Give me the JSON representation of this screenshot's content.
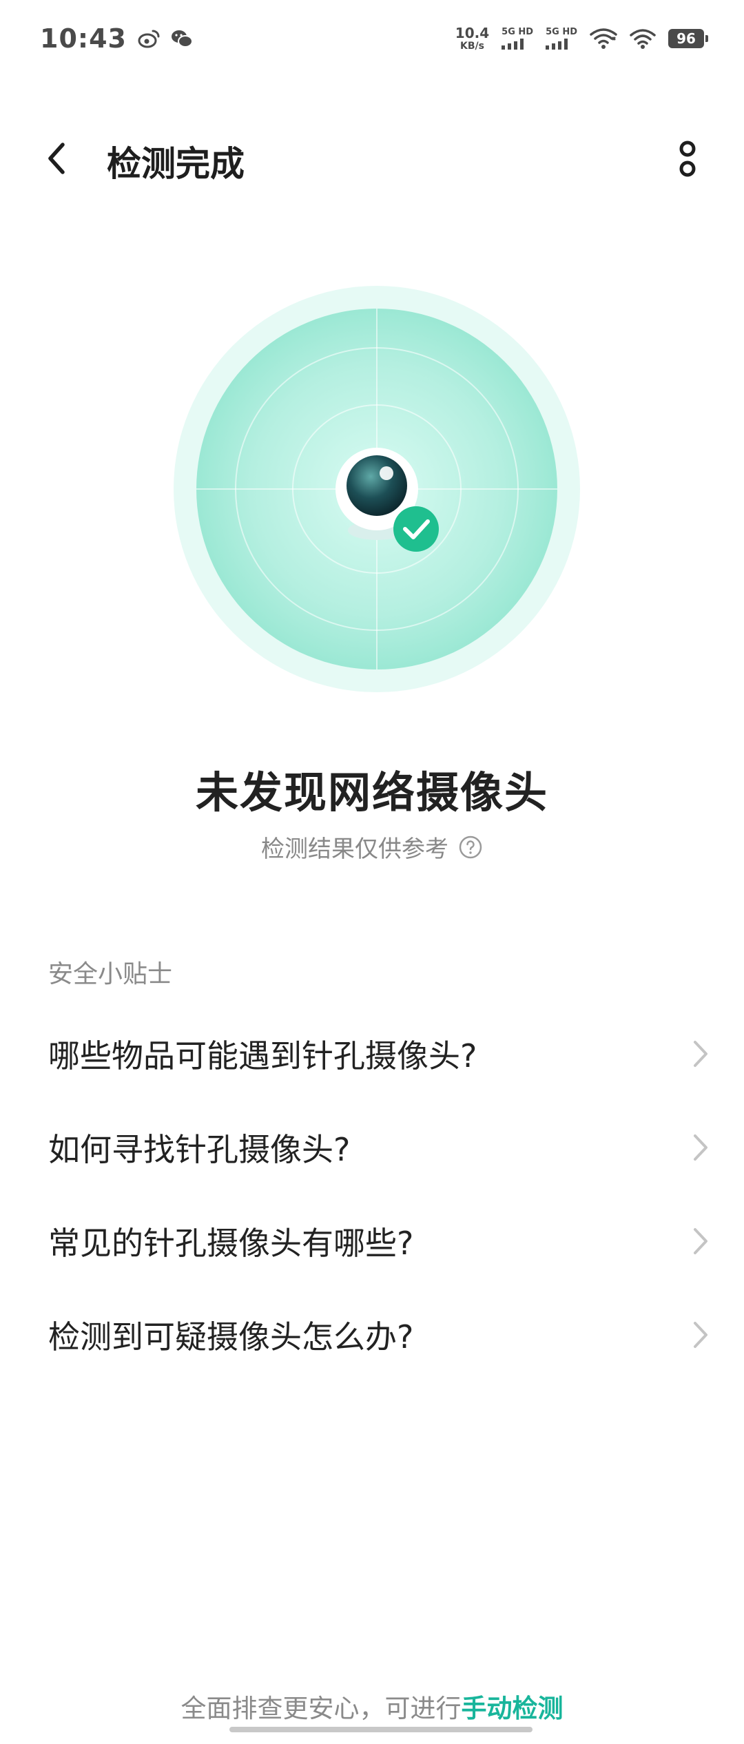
{
  "status_bar": {
    "time": "10:43",
    "net_speed_value": "10.4",
    "net_speed_unit": "KB/s",
    "sim1_label": "5G HD",
    "sim2_label": "5G HD",
    "battery": "96"
  },
  "header": {
    "title": "检测完成"
  },
  "result": {
    "title": "未发现网络摄像头",
    "subtitle": "检测结果仅供参考"
  },
  "tips": {
    "label": "安全小贴士",
    "items": [
      {
        "label": "哪些物品可能遇到针孔摄像头?"
      },
      {
        "label": "如何寻找针孔摄像头?"
      },
      {
        "label": "常见的针孔摄像头有哪些?"
      },
      {
        "label": "检测到可疑摄像头怎么办?"
      }
    ]
  },
  "footer": {
    "prefix": "全面排查更安心，可进行",
    "link": "手动检测"
  },
  "colors": {
    "accent": "#18b59b",
    "radar_outer": "#e6faf5",
    "radar_inner": "#b8f0e2",
    "check_badge": "#1fbf8f"
  }
}
